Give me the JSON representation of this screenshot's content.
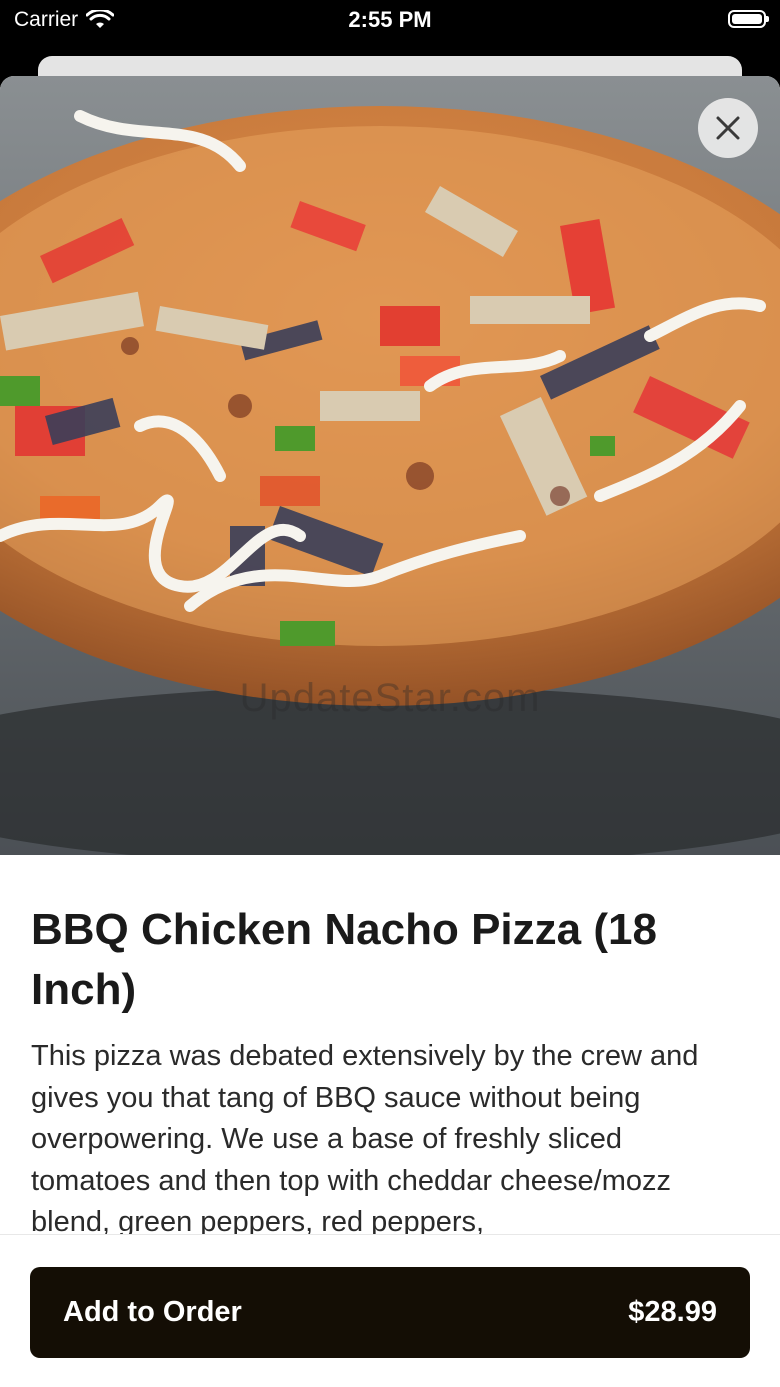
{
  "status_bar": {
    "carrier": "Carrier",
    "time": "2:55 PM",
    "icons": [
      "wifi-icon",
      "battery-icon"
    ]
  },
  "item": {
    "image_alt": "pizza-photo",
    "watermark": "UpdateStar.com",
    "title": "BBQ Chicken Nacho Pizza (18 Inch)",
    "description": "This pizza was debated extensively by the crew and gives you that tang of BBQ sauce without being overpowering. We use a base of freshly sliced tomatoes and then top with cheddar cheese/mozz blend, green peppers, red peppers,"
  },
  "footer": {
    "add_label": "Add to Order",
    "price": "$28.99"
  },
  "colors": {
    "button_bg": "#140e05",
    "button_text": "#ffffff",
    "title_text": "#1a1a1a"
  }
}
